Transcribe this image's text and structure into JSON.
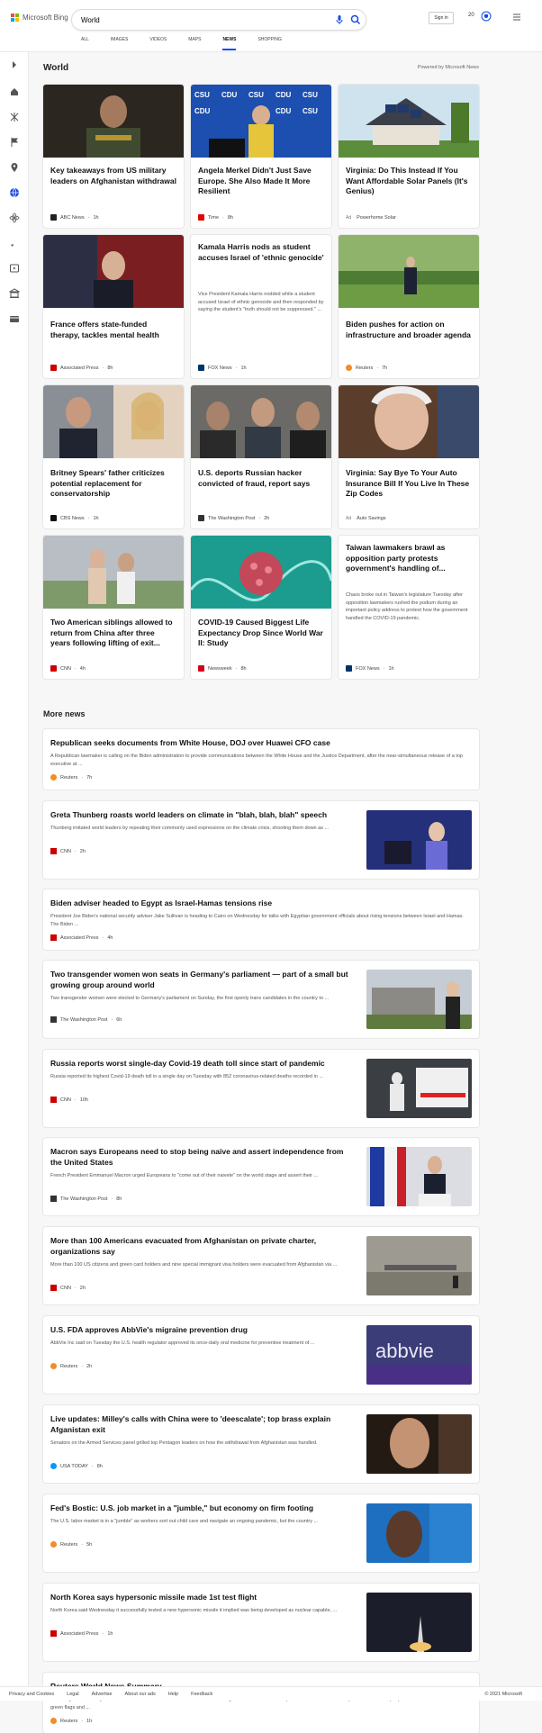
{
  "header": {
    "brand": "Microsoft Bing",
    "search_value": "World",
    "signin": "Sign in",
    "rewards_points": "20"
  },
  "tabs": [
    "ALL",
    "IMAGES",
    "VIDEOS",
    "MAPS",
    "NEWS",
    "SHOPPING"
  ],
  "active_tab": "NEWS",
  "section": {
    "title": "World",
    "powered": "Powered by Microsoft News"
  },
  "cards": [
    {
      "title": "Key takeaways from US military leaders on Afghanistan withdrawal",
      "source": "ABC News",
      "time": "1h",
      "logo_color": "#222"
    },
    {
      "title": "Angela Merkel Didn't Just Save Europe. She Also Made It More Resilient",
      "source": "Time",
      "time": "8h",
      "logo_color": "#e10600"
    },
    {
      "title": "Virginia: Do This Instead If You Want Affordable Solar Panels (It's Genius)",
      "ad": "Ad",
      "source": "Powerhome Solar",
      "time": ""
    },
    {
      "title": "France offers state-funded therapy, tackles mental health",
      "source": "Associated Press",
      "time": "8h",
      "logo_color": "#c00"
    },
    {
      "title": "Kamala Harris nods as student accuses Israel of 'ethnic genocide'",
      "desc": "Vice President Kamala Harris nodded while a student accused Israel of ethnic genocide and then responded by saying the student's \"truth should not be suppressed.\" ...",
      "source": "FOX News",
      "time": "1h",
      "logo_color": "#003366"
    },
    {
      "title": "Biden pushes for action on infrastructure and broader agenda",
      "source": "Reuters",
      "time": "7h",
      "logo_color": "#f28c28"
    },
    {
      "title": "Britney Spears' father criticizes potential replacement for conservatorship",
      "source": "CBS News",
      "time": "1h",
      "logo_color": "#111"
    },
    {
      "title": "U.S. deports Russian hacker convicted of fraud, report says",
      "source": "The Washington Post",
      "time": "2h",
      "logo_color": "#333"
    },
    {
      "title": "Virginia: Say Bye To Your Auto Insurance Bill If You Live In These Zip Codes",
      "ad": "Ad",
      "source": "Auto Savings",
      "time": ""
    },
    {
      "title": "Two American siblings allowed to return from China after three years following lifting of exit...",
      "source": "CNN",
      "time": "4h",
      "logo_color": "#cc0000"
    },
    {
      "title": "COVID-19 Caused Biggest Life Expectancy Drop Since World War II: Study",
      "source": "Newsweek",
      "time": "8h",
      "logo_color": "#d0021b"
    },
    {
      "title": "Taiwan lawmakers brawl as opposition party protests government's handling of...",
      "desc": "Chaos broke out in Taiwan's legislature Tuesday after opposition lawmakers rushed the podium during an important policy address to protest how the government handled the COVID-19 pandemic.",
      "source": "FOX News",
      "time": "1h",
      "logo_color": "#003366"
    }
  ],
  "more_news_title": "More news",
  "more_news": [
    {
      "title": "Republican seeks documents from White House, DOJ over Huawei CFO case",
      "desc": "A Republican lawmaker is calling on the Biden administration to provide communications between the White House and the Justice Department, after the near-simultaneous release of a top executive at ...",
      "source": "Reuters",
      "time": "7h",
      "logo_color": "#f28c28"
    },
    {
      "title": "Greta Thunberg roasts world leaders on climate in \"blah, blah, blah\" speech",
      "desc": "Thunberg imitated world leaders by repeating their commonly used expressions on the climate crisis, shooting them down as ...",
      "source": "CNN",
      "time": "2h",
      "logo_color": "#cc0000"
    },
    {
      "title": "Biden adviser headed to Egypt as Israel-Hamas tensions rise",
      "desc": "President Joe Biden's national security adviser Jake Sullivan is heading to Cairo on Wednesday for talks with Egyptian government officials about rising tensions between Israel and Hamas. The Biden ...",
      "source": "Associated Press",
      "time": "4h",
      "logo_color": "#c00"
    },
    {
      "title": "Two transgender women won seats in Germany's parliament — part of a small but growing group around world",
      "desc": "Two transgender women were elected to Germany's parliament on Sunday, the first openly trans candidates in the country to ...",
      "source": "The Washington Post",
      "time": "6h",
      "logo_color": "#333"
    },
    {
      "title": "Russia reports worst single-day Covid-19 death toll since start of pandemic",
      "desc": "Russia reported its highest Covid-19 death toll in a single day on Tuesday with 852 coronavirus-related deaths recorded in ...",
      "source": "CNN",
      "time": "10h",
      "logo_color": "#cc0000"
    },
    {
      "title": "Macron says Europeans need to stop being naive and assert independence from the United States",
      "desc": "French President Emmanuel Macron urged Europeans to \"come out of their naivete\" on the world stage and assert their ...",
      "source": "The Washington Post",
      "time": "8h",
      "logo_color": "#333"
    },
    {
      "title": "More than 100 Americans evacuated from Afghanistan on private charter, organizations say",
      "desc": "More than 100 US citizens and green card holders and nine special immigrant visa holders were evacuated from Afghanistan via ...",
      "source": "CNN",
      "time": "2h",
      "logo_color": "#cc0000"
    },
    {
      "title": "U.S. FDA approves AbbVie's migraine prevention drug",
      "desc": "AbbVie Inc said on Tuesday the U.S. health regulator approved its once-daily oral medicine for preventive treatment of ...",
      "source": "Reuters",
      "time": "2h",
      "logo_color": "#f28c28"
    },
    {
      "title": "Live updates: Milley's calls with China were to 'deescalate'; top brass explain Afganistan exit",
      "desc": "Senators on the Armed Services panel grilled top Pentagon leaders on how the withdrawal from Afghanistan was handled.",
      "source": "USA TODAY",
      "time": "8h",
      "logo_color": "#009bff"
    },
    {
      "title": "Fed's Bostic: U.S. job market in a \"jumble,\" but economy on firm footing",
      "desc": "The U.S. labor market is in a \"jumble\" as workers sort out child care and navigate an ongoing pandemic, but the country ...",
      "source": "Reuters",
      "time": "5h",
      "logo_color": "#f28c28"
    },
    {
      "title": "North Korea says hypersonic missile made 1st test flight",
      "desc": "North Korea said Wednesday it successfully tested a new hypersonic missile it implied was being developed as nuclear capable, ...",
      "source": "Associated Press",
      "time": "1h",
      "logo_color": "#c00"
    },
    {
      "title": "Reuters World News Summary",
      "desc": "Following is a summary of current world news briefs. El Salvador women march against abortion laws amid planned Latin America-wide protests Scores of people in El Salvador waved green flags and ...",
      "source": "Reuters",
      "time": "1h",
      "logo_color": "#f28c28"
    }
  ],
  "footer": {
    "links": [
      "Privacy and Cookies",
      "Legal",
      "Advertise",
      "About our ads",
      "Help",
      "Feedback"
    ],
    "copyright": "© 2021 Microsoft"
  }
}
